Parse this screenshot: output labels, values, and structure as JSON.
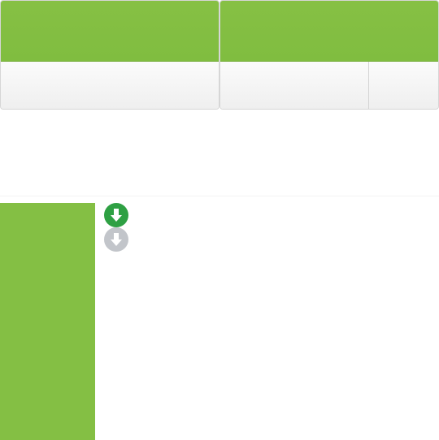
{
  "cards": {
    "left": {
      "header": "",
      "body": ""
    },
    "right": {
      "header": "",
      "cells": [
        "",
        ""
      ]
    }
  },
  "icons": {
    "download_active": {
      "name": "download-arrow-icon",
      "color": "#2ea043"
    },
    "download_inactive": {
      "name": "download-arrow-icon",
      "color": "#c2c5ca"
    }
  },
  "colors": {
    "accent_green": "#84bf44",
    "header_border": "#76ad3a"
  }
}
